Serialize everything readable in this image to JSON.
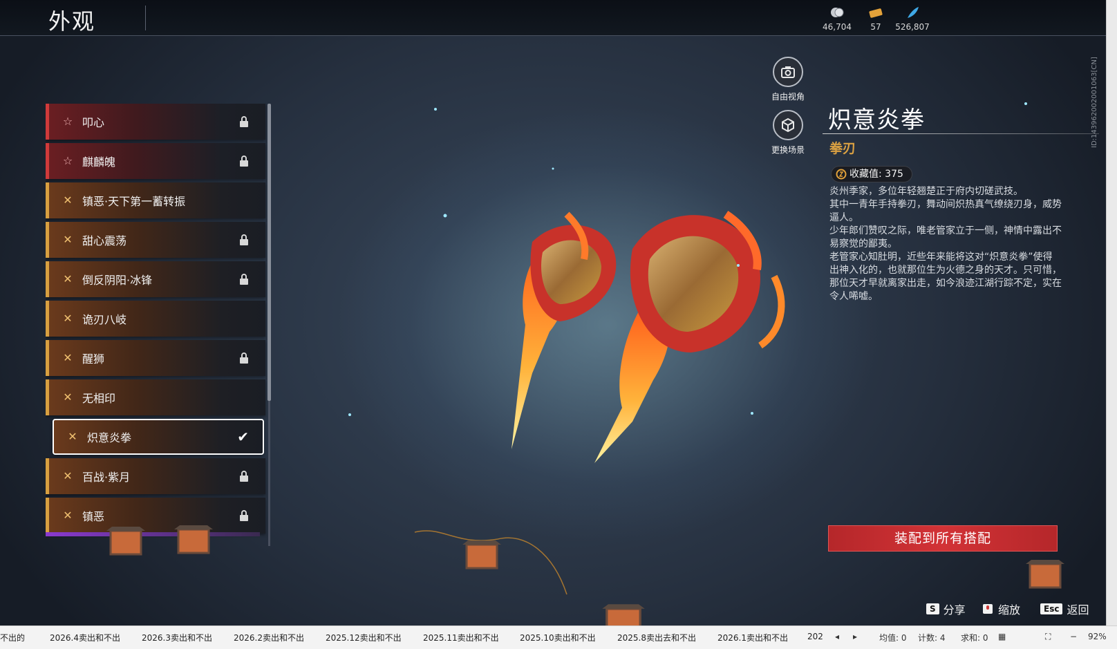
{
  "header": {
    "title": "外观",
    "currencies": [
      {
        "icon": "silver-coin-icon",
        "value": "46,704"
      },
      {
        "icon": "ticket-icon",
        "value": "57"
      },
      {
        "icon": "feather-icon",
        "value": "526,807"
      }
    ]
  },
  "skin_list": {
    "items": [
      {
        "label": "叩心",
        "rarity": "red",
        "locked": true
      },
      {
        "label": "麒麟魄",
        "rarity": "red",
        "locked": true
      },
      {
        "label": "镇恶·天下第一蓄转振",
        "rarity": "gold",
        "locked": false
      },
      {
        "label": "甜心震荡",
        "rarity": "gold",
        "locked": true
      },
      {
        "label": "倒反阴阳·冰锋",
        "rarity": "gold",
        "locked": true
      },
      {
        "label": "诡刃八岐",
        "rarity": "gold",
        "locked": false
      },
      {
        "label": "醒狮",
        "rarity": "gold",
        "locked": true
      },
      {
        "label": "无相印",
        "rarity": "gold",
        "locked": false
      },
      {
        "label": "炽意炎拳",
        "rarity": "gold",
        "locked": false,
        "selected": true
      },
      {
        "label": "百战·紫月",
        "rarity": "gold",
        "locked": true
      },
      {
        "label": "镇恶",
        "rarity": "gold",
        "locked": true
      }
    ]
  },
  "view_controls": {
    "free_camera_label": "自由视角",
    "change_scene_label": "更换场景"
  },
  "detail": {
    "name": "炽意炎拳",
    "type": "拳刃",
    "collection_label": "收藏值: 375",
    "description": [
      "炎州季家，多位年轻翘楚正于府内切磋武技。",
      "其中一青年手持拳刃，舞动间炽热真气缭绕刃身，威势逼人。",
      "少年郎们赞叹之际，唯老管家立于一侧，神情中露出不易察觉的鄙夷。",
      "老管家心知肚明，近些年来能将这对“炽意炎拳”使得出神入化的，也就那位生为火德之身的天才。只可惜，那位天才早就离家出走，如今浪迹江湖行踪不定，实在令人唏嘘。"
    ],
    "equip_button": "装配到所有搭配"
  },
  "player_id": "ID:143962002001063[CN]",
  "hotkeys": [
    {
      "key": "S",
      "label": "分享"
    },
    {
      "key": "mouse",
      "label": "缩放"
    },
    {
      "key": "Esc",
      "label": "返回"
    }
  ],
  "taskbar": {
    "sheet_tabs": [
      "不出的",
      "2026.4卖出和不出",
      "2026.3卖出和不出",
      "2026.2卖出和不出",
      "2025.12卖出和不出",
      "2025.11卖出和不出",
      "2025.10卖出和不出",
      "2025.8卖出去和不出",
      "2026.1卖出和不出",
      "202"
    ],
    "avg": "均值: 0",
    "count": "计数: 4",
    "sum": "求和: 0",
    "zoom": "92%"
  },
  "colors": {
    "accent_red": "#d23236",
    "rarity_red": "#d03a3a",
    "rarity_gold": "#d8a040",
    "item_type": "#d9a042"
  }
}
